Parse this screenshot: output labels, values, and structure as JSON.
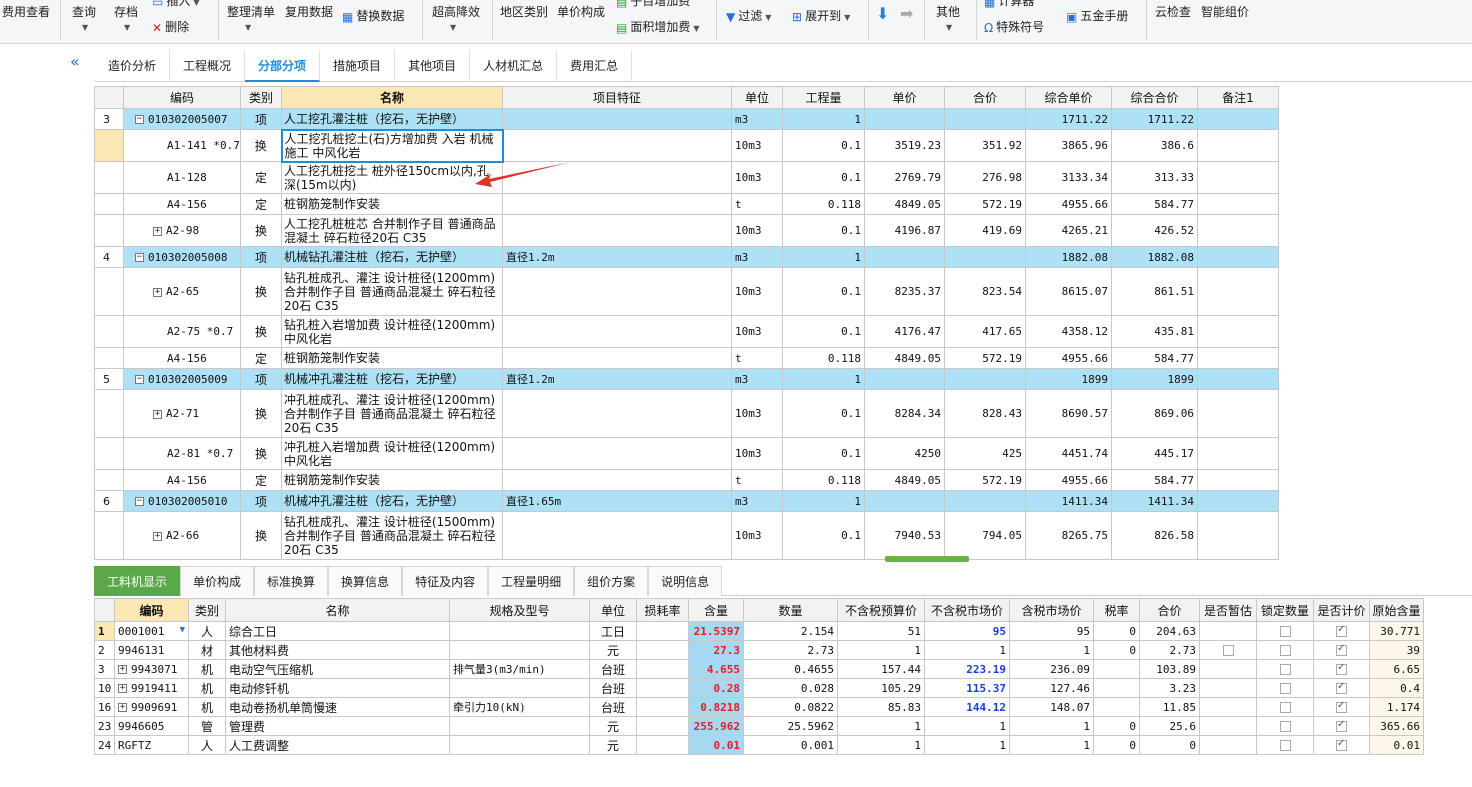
{
  "toolbar": {
    "fee_view": "费用查看",
    "query": "查询",
    "save": "存档",
    "insert": "插入",
    "delete": "删除",
    "organize_list": "整理清单",
    "reuse_data": "复用数据",
    "replace_data": "替换数据",
    "height_reduction": "超高降效",
    "region_category": "地区类别",
    "unit_price_comp": "单价构成",
    "sub_item_fee": "子目增加费",
    "area_fee": "面积增加费",
    "filter": "过滤",
    "expand_to": "展开到",
    "other": "其他",
    "calculator": "计算器",
    "special_symbol": "特殊符号",
    "hardware_manual": "五金手册",
    "cloud_check": "云检查",
    "smart_price": "智能组价"
  },
  "tabs": [
    "造价分析",
    "工程概况",
    "分部分项",
    "措施项目",
    "其他项目",
    "人材机汇总",
    "费用汇总"
  ],
  "active_tab": "分部分项",
  "upper_table": {
    "headers": [
      "",
      "编码",
      "类别",
      "名称",
      "项目特征",
      "单位",
      "工程量",
      "单价",
      "合价",
      "综合单价",
      "综合合价",
      "备注1"
    ],
    "rows": [
      {
        "idx": "3",
        "code": "010302005007",
        "type": "项",
        "name": "人工挖孔灌注桩（挖石，无护壁）",
        "feature": "",
        "unit": "m3",
        "qty": "1",
        "price": "",
        "total": "",
        "cprice": "1711.22",
        "ctotal": "1711.22"
      },
      {
        "idx": "",
        "code": "A1-141 *0.7",
        "type": "换",
        "name": "人工挖孔桩挖土(石)方增加费 入岩 机械施工  中风化岩",
        "feature": "",
        "unit": "10m3",
        "qty": "0.1",
        "price": "3519.23",
        "total": "351.92",
        "cprice": "3865.96",
        "ctotal": "386.6"
      },
      {
        "idx": "",
        "code": "A1-128",
        "type": "定",
        "name": "人工挖孔桩挖土 桩外径150cm以内,孔深(15m以内)",
        "feature": "",
        "unit": "10m3",
        "qty": "0.1",
        "price": "2769.79",
        "total": "276.98",
        "cprice": "3133.34",
        "ctotal": "313.33"
      },
      {
        "idx": "",
        "code": "A4-156",
        "type": "定",
        "name": "桩钢筋笼制作安装",
        "feature": "",
        "unit": "t",
        "qty": "0.118",
        "price": "4849.05",
        "total": "572.19",
        "cprice": "4955.66",
        "ctotal": "584.77"
      },
      {
        "idx": "",
        "code": "A2-98",
        "type": "换",
        "name": "人工挖孔桩桩芯  合并制作子目 普通商品混凝土 碎石粒径20石 C35",
        "feature": "",
        "unit": "10m3",
        "qty": "0.1",
        "price": "4196.87",
        "total": "419.69",
        "cprice": "4265.21",
        "ctotal": "426.52"
      },
      {
        "idx": "4",
        "code": "010302005008",
        "type": "项",
        "name": "机械钻孔灌注桩（挖石，无护壁）",
        "feature": "直径1.2m",
        "unit": "m3",
        "qty": "1",
        "price": "",
        "total": "",
        "cprice": "1882.08",
        "ctotal": "1882.08"
      },
      {
        "idx": "",
        "code": "A2-65",
        "type": "换",
        "name": "钻孔桩成孔、灌注 设计桩径(1200mm) 合并制作子目 普通商品混凝土 碎石粒径20石 C35",
        "feature": "",
        "unit": "10m3",
        "qty": "0.1",
        "price": "8235.37",
        "total": "823.54",
        "cprice": "8615.07",
        "ctotal": "861.51"
      },
      {
        "idx": "",
        "code": "A2-75 *0.7",
        "type": "换",
        "name": "钻孔桩入岩增加费 设计桩径(1200mm) 中风化岩",
        "feature": "",
        "unit": "10m3",
        "qty": "0.1",
        "price": "4176.47",
        "total": "417.65",
        "cprice": "4358.12",
        "ctotal": "435.81"
      },
      {
        "idx": "",
        "code": "A4-156",
        "type": "定",
        "name": "桩钢筋笼制作安装",
        "feature": "",
        "unit": "t",
        "qty": "0.118",
        "price": "4849.05",
        "total": "572.19",
        "cprice": "4955.66",
        "ctotal": "584.77"
      },
      {
        "idx": "5",
        "code": "010302005009",
        "type": "项",
        "name": "机械冲孔灌注桩（挖石，无护壁）",
        "feature": "直径1.2m",
        "unit": "m3",
        "qty": "1",
        "price": "",
        "total": "",
        "cprice": "1899",
        "ctotal": "1899"
      },
      {
        "idx": "",
        "code": "A2-71",
        "type": "换",
        "name": "冲孔桩成孔、灌注 设计桩径(1200mm) 合并制作子目 普通商品混凝土 碎石粒径20石 C35",
        "feature": "",
        "unit": "10m3",
        "qty": "0.1",
        "price": "8284.34",
        "total": "828.43",
        "cprice": "8690.57",
        "ctotal": "869.06"
      },
      {
        "idx": "",
        "code": "A2-81 *0.7",
        "type": "换",
        "name": "冲孔桩入岩增加费 设计桩径(1200mm) 中风化岩",
        "feature": "",
        "unit": "10m3",
        "qty": "0.1",
        "price": "4250",
        "total": "425",
        "cprice": "4451.74",
        "ctotal": "445.17"
      },
      {
        "idx": "",
        "code": "A4-156",
        "type": "定",
        "name": "桩钢筋笼制作安装",
        "feature": "",
        "unit": "t",
        "qty": "0.118",
        "price": "4849.05",
        "total": "572.19",
        "cprice": "4955.66",
        "ctotal": "584.77"
      },
      {
        "idx": "6",
        "code": "010302005010",
        "type": "项",
        "name": "机械冲孔灌注桩（挖石，无护壁）",
        "feature": "直径1.65m",
        "unit": "m3",
        "qty": "1",
        "price": "",
        "total": "",
        "cprice": "1411.34",
        "ctotal": "1411.34"
      },
      {
        "idx": "",
        "code": "A2-66",
        "type": "换",
        "name": "钻孔桩成孔、灌注 设计桩径(1500mm) 合并制作子目 普通商品混凝土 碎石粒径20石 C35",
        "feature": "",
        "unit": "10m3",
        "qty": "0.1",
        "price": "7940.53",
        "total": "794.05",
        "cprice": "8265.75",
        "ctotal": "826.58"
      }
    ]
  },
  "bottom_tabs": [
    "工料机显示",
    "单价构成",
    "标准换算",
    "换算信息",
    "特征及内容",
    "工程量明细",
    "组价方案",
    "说明信息"
  ],
  "active_bottom_tab": "工料机显示",
  "lower_table": {
    "headers": [
      "",
      "编码",
      "类别",
      "名称",
      "规格及型号",
      "单位",
      "损耗率",
      "含量",
      "数量",
      "不含税预算价",
      "不含税市场价",
      "含税市场价",
      "税率",
      "合价",
      "是否暂估",
      "锁定数量",
      "是否计价",
      "原始含量"
    ],
    "rows": [
      {
        "idx": "1",
        "code": "0001001",
        "type": "人",
        "name": "综合工日",
        "spec": "",
        "unit": "工日",
        "loss": "",
        "content": "21.5397",
        "amount": "2.154",
        "budget": "51",
        "market": "95",
        "taxmarket": "95",
        "tax": "0",
        "total": "204.63",
        "est": "",
        "lock": false,
        "priced": true,
        "orig": "30.771"
      },
      {
        "idx": "2",
        "code": "9946131",
        "type": "材",
        "name": "其他材料费",
        "spec": "",
        "unit": "元",
        "loss": "",
        "content": "27.3",
        "amount": "2.73",
        "budget": "1",
        "market": "1",
        "taxmarket": "1",
        "tax": "0",
        "total": "2.73",
        "est": "box",
        "lock": false,
        "priced": true,
        "orig": "39"
      },
      {
        "idx": "3",
        "code": "9943071",
        "type": "机",
        "name": "电动空气压缩机",
        "spec": "排气量3(m3/min)",
        "unit": "台班",
        "loss": "",
        "content": "4.655",
        "amount": "0.4655",
        "budget": "157.44",
        "market": "223.19",
        "taxmarket": "236.09",
        "tax": "",
        "total": "103.89",
        "est": "",
        "lock": false,
        "priced": true,
        "orig": "6.65"
      },
      {
        "idx": "10",
        "code": "9919411",
        "type": "机",
        "name": "电动修钎机",
        "spec": "",
        "unit": "台班",
        "loss": "",
        "content": "0.28",
        "amount": "0.028",
        "budget": "105.29",
        "market": "115.37",
        "taxmarket": "127.46",
        "tax": "",
        "total": "3.23",
        "est": "",
        "lock": false,
        "priced": true,
        "orig": "0.4"
      },
      {
        "idx": "16",
        "code": "9909691",
        "type": "机",
        "name": "电动卷扬机单筒慢速",
        "spec": "牵引力10(kN)",
        "unit": "台班",
        "loss": "",
        "content": "0.8218",
        "amount": "0.0822",
        "budget": "85.83",
        "market": "144.12",
        "taxmarket": "148.07",
        "tax": "",
        "total": "11.85",
        "est": "",
        "lock": false,
        "priced": true,
        "orig": "1.174"
      },
      {
        "idx": "23",
        "code": "9946605",
        "type": "管",
        "name": "管理费",
        "spec": "",
        "unit": "元",
        "loss": "",
        "content": "255.962",
        "amount": "25.5962",
        "budget": "1",
        "market": "1",
        "taxmarket": "1",
        "tax": "0",
        "total": "25.6",
        "est": "",
        "lock": false,
        "priced": true,
        "orig": "365.66"
      },
      {
        "idx": "24",
        "code": "RGFTZ",
        "type": "人",
        "name": "人工费调整",
        "spec": "",
        "unit": "元",
        "loss": "",
        "content": "0.01",
        "amount": "0.001",
        "budget": "1",
        "market": "1",
        "taxmarket": "1",
        "tax": "0",
        "total": "0",
        "est": "",
        "lock": false,
        "priced": true,
        "orig": "0.01"
      }
    ]
  }
}
